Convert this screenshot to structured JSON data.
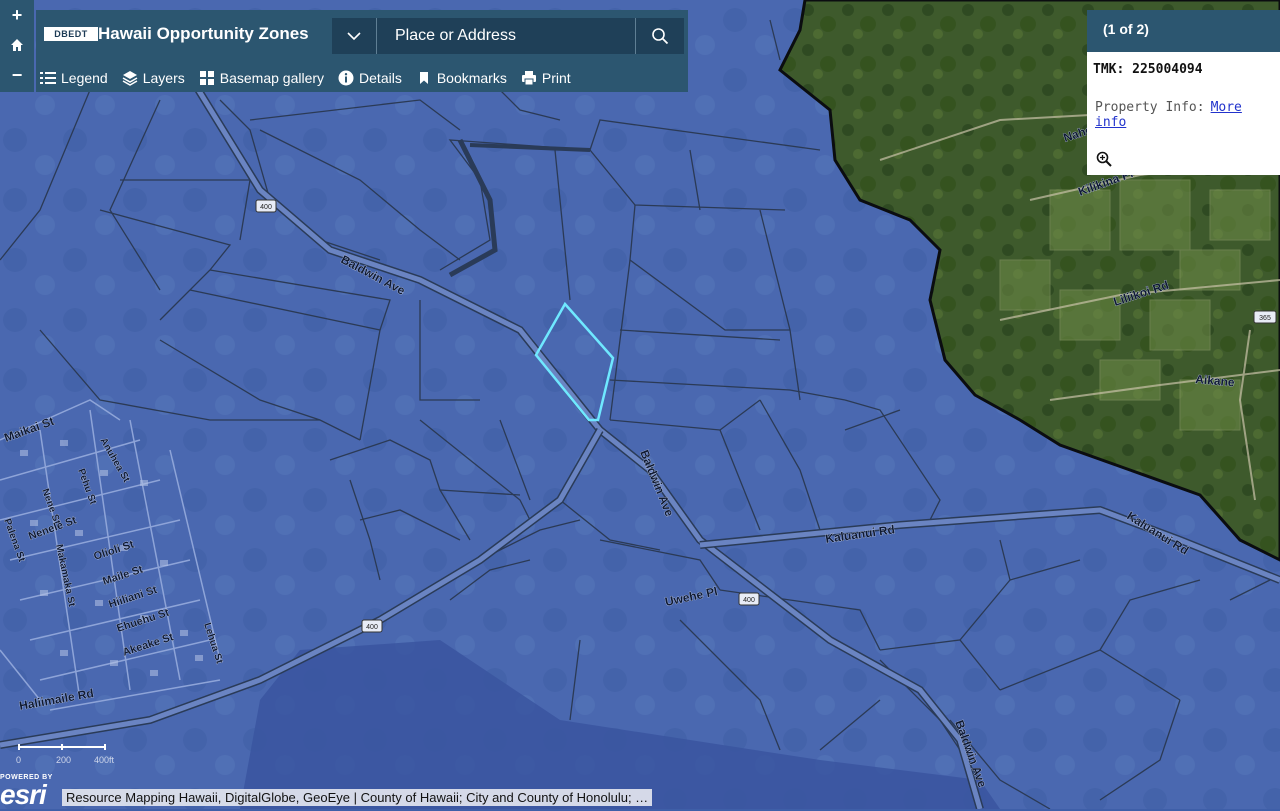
{
  "zoom": {
    "in_label": "+",
    "home_icon": "home-icon",
    "out_label": "−"
  },
  "header": {
    "logo_text": "DBEDT",
    "title": "Hawaii Opportunity Zones",
    "search_placeholder": "Place or Address"
  },
  "toolbar": {
    "legend": "Legend",
    "layers": "Layers",
    "basemap": "Basemap gallery",
    "details": "Details",
    "bookmarks": "Bookmarks",
    "print": "Print"
  },
  "popup": {
    "counter": "(1 of 2)",
    "title": "TMK: 225004094",
    "info_label": "Property Info:",
    "info_link": "More info"
  },
  "map_labels": {
    "baldwin_ave_1": "Baldwin Ave",
    "baldwin_ave_2": "Baldwin Ave",
    "baldwin_ave_3": "Baldwin Ave",
    "kaluanui_rd_1": "Kaluanui Rd",
    "kaluanui_rd_2": "Kaluanui Rd",
    "uwehe_pl": "Uwehe Pl",
    "haliimaile_rd": "Haliimaile Rd",
    "nahoa_pl": "Nahoa Pl",
    "kilikina_pl": "Kilikina Pl",
    "liliikoi_rd": "Liliikoi Rd",
    "aikane": "Aikane",
    "maikai_st": "Maikai St",
    "anuhea_st": "Anuhea St",
    "pehu_st": "Pehu St",
    "nene_st": "Nene St",
    "nenele_st": "Nenele St",
    "olioli_st": "Olioli St",
    "maile_st": "Maile St",
    "hiiliani_st": "Hiiliani St",
    "ehuehu_st": "Ehuehu St",
    "akeake_st": "Akeake St",
    "makamaka_st": "Makamaka St",
    "lehua_st": "Lehua St",
    "palena_st": "Palena St",
    "shield_400a": "400",
    "shield_400b": "400",
    "shield_400c": "400",
    "shield_365": "365"
  },
  "scale": {
    "labels": [
      "0",
      "200",
      "400ft"
    ]
  },
  "attribution": "Resource Mapping Hawaii, DigitalGlobe, GeoEye | County of Hawaii; City and County of Honolulu; …",
  "esri": {
    "powered_by": "POWERED BY",
    "word": "esri"
  },
  "colors": {
    "overlay_blue": "#3f5fa8",
    "selected_parcel": "#6fe8ff",
    "header_bg": "#2c5670",
    "parcel_line": "#2b3a55"
  }
}
